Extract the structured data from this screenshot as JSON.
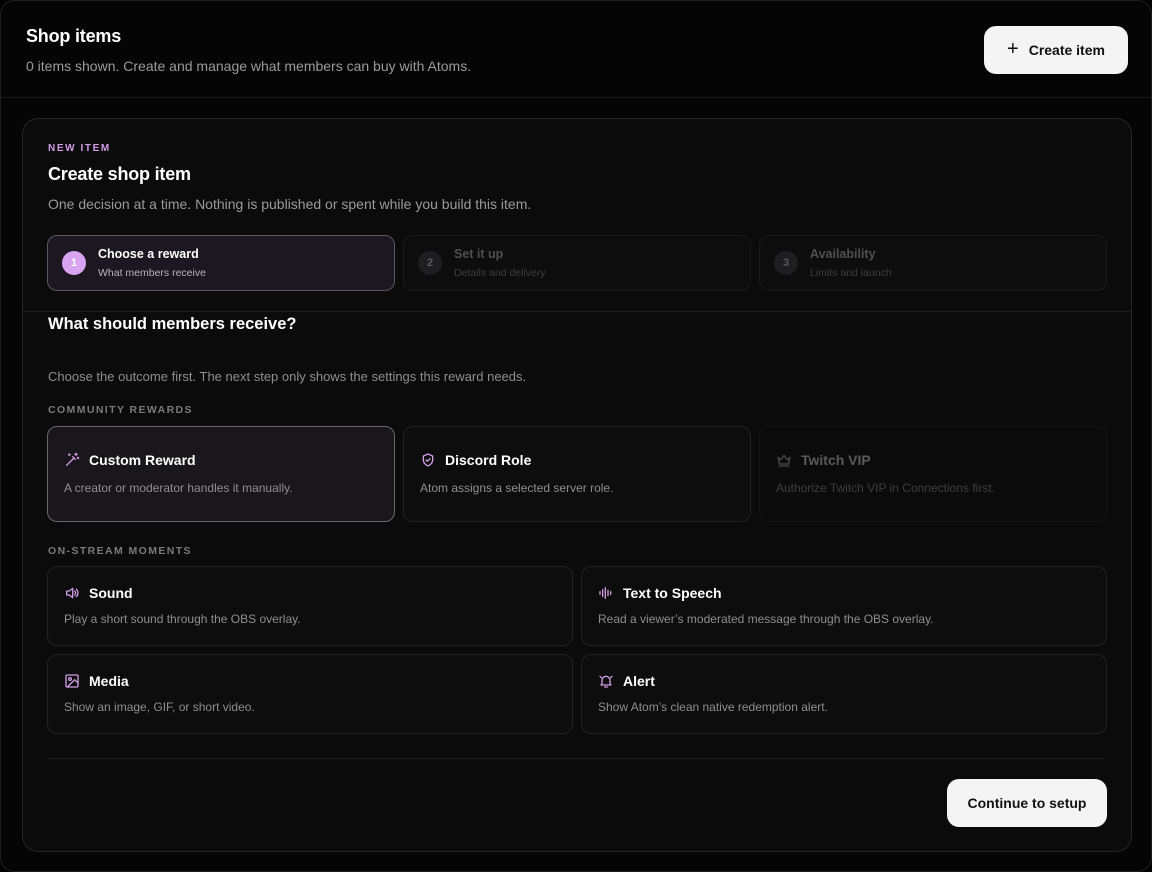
{
  "header": {
    "title": "Shop items",
    "subtitle": "0 items shown. Create and manage what members can buy with Atoms.",
    "create_button": "Create item"
  },
  "panel": {
    "eyebrow": "NEW ITEM",
    "title": "Create shop item",
    "description": "One decision at a time. Nothing is published or spent while you build this item."
  },
  "steps": [
    {
      "number": "1",
      "title": "Choose a reward",
      "subtitle": "What members receive",
      "active": true
    },
    {
      "number": "2",
      "title": "Set it up",
      "subtitle": "Details and delivery",
      "active": false
    },
    {
      "number": "3",
      "title": "Availability",
      "subtitle": "Limits and launch",
      "active": false
    }
  ],
  "question": {
    "title": "What should members receive?",
    "description": "Choose the outcome first. The next step only shows the settings this reward needs."
  },
  "community_rewards": {
    "label": "COMMUNITY REWARDS",
    "items": [
      {
        "icon": "magic-wand-icon",
        "title": "Custom Reward",
        "description": "A creator or moderator handles it manually.",
        "state": "selected"
      },
      {
        "icon": "shield-icon",
        "title": "Discord Role",
        "description": "Atom assigns a selected server role.",
        "state": "default"
      },
      {
        "icon": "crown-icon",
        "title": "Twitch VIP",
        "description": "Authorize Twitch VIP in Connections first.",
        "state": "disabled"
      }
    ]
  },
  "on_stream_moments": {
    "label": "ON-STREAM MOMENTS",
    "items": [
      {
        "icon": "speaker-icon",
        "title": "Sound",
        "description": "Play a short sound through the OBS overlay."
      },
      {
        "icon": "audio-waveform-icon",
        "title": "Text to Speech",
        "description": "Read a viewer’s moderated message through the OBS overlay."
      },
      {
        "icon": "image-icon",
        "title": "Media",
        "description": "Show an image, GIF, or short video."
      },
      {
        "icon": "bell-ring-icon",
        "title": "Alert",
        "description": "Show Atom’s clean native redemption alert."
      }
    ]
  },
  "footer": {
    "continue_button": "Continue to setup"
  },
  "colors": {
    "accent": "#d19be6",
    "step_active_dot": "#d8a3f0",
    "button_bg": "#f4f4f4",
    "background": "#050505"
  }
}
